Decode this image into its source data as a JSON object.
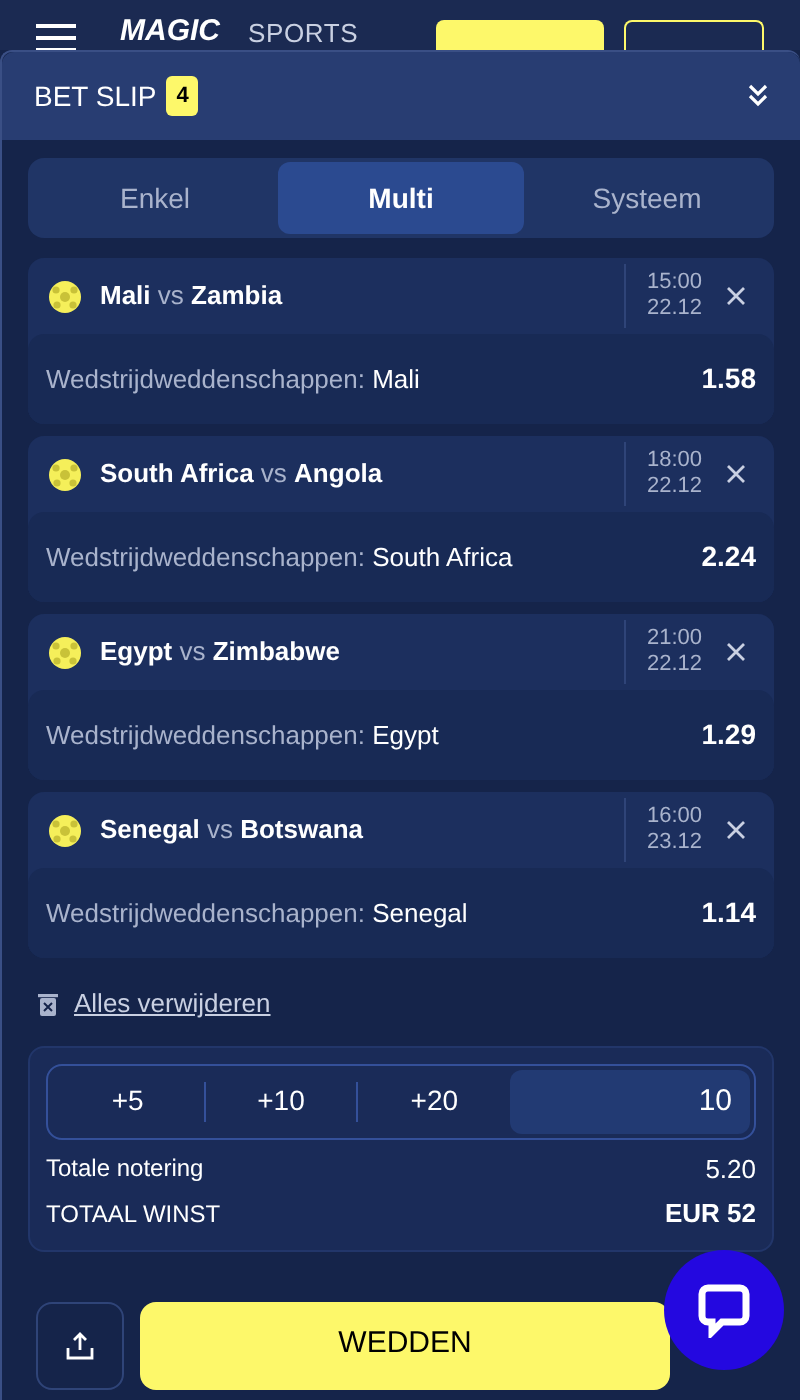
{
  "header": {
    "logo": "MAGIC",
    "logo_sub": "SPORTS",
    "buttons": [
      {
        "kind": "primary"
      },
      {
        "kind": "outline"
      }
    ]
  },
  "bet_slip": {
    "title": "BET SLIP",
    "count": "4",
    "tabs": [
      {
        "label": "Enkel",
        "selected": false
      },
      {
        "label": "Multi",
        "selected": true
      },
      {
        "label": "Systeem",
        "selected": false
      }
    ],
    "selections": [
      {
        "home": "Mali",
        "vs": "vs",
        "away": "Zambia",
        "time": "15:00",
        "date": "22.12",
        "market": "Wedstrijdweddenschappen:",
        "pick": "Mali",
        "odds": "1.58"
      },
      {
        "home": "South Africa",
        "vs": "vs",
        "away": "Angola",
        "time": "18:00",
        "date": "22.12",
        "market": "Wedstrijdweddenschappen:",
        "pick": "South Africa",
        "odds": "2.24"
      },
      {
        "home": "Egypt",
        "vs": "vs",
        "away": "Zimbabwe",
        "time": "21:00",
        "date": "22.12",
        "market": "Wedstrijdweddenschappen:",
        "pick": "Egypt",
        "odds": "1.29"
      },
      {
        "home": "Senegal",
        "vs": "vs",
        "away": "Botswana",
        "time": "16:00",
        "date": "23.12",
        "market": "Wedstrijdweddenschappen:",
        "pick": "Senegal",
        "odds": "1.14"
      }
    ],
    "remove_all": "Alles verwijderen",
    "stake": {
      "quick_amounts": [
        "+5",
        "+10",
        "+20"
      ],
      "value": "10"
    },
    "totals": [
      {
        "kind": "odds",
        "label": "Totale notering",
        "value": "5.20"
      },
      {
        "kind": "win",
        "label": "TOTAAL WINST",
        "value": "EUR 52"
      }
    ],
    "place_button": "WEDDEN"
  }
}
